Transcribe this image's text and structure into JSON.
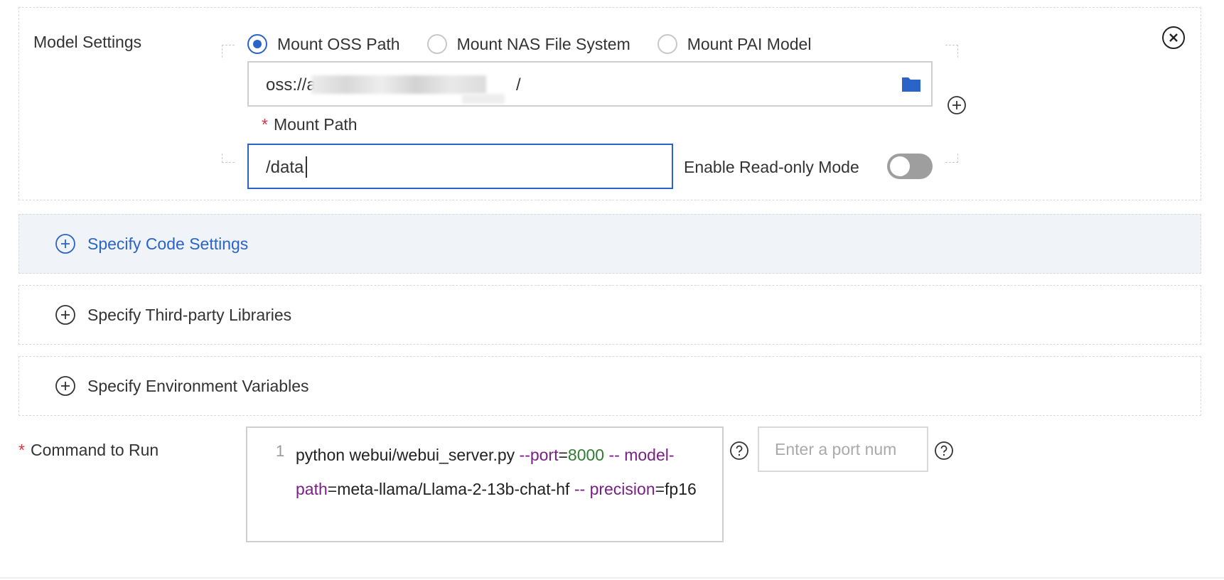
{
  "model_settings": {
    "label": "Model Settings",
    "radios": [
      {
        "label": "Mount OSS Path",
        "checked": true
      },
      {
        "label": "Mount NAS File System",
        "checked": false
      },
      {
        "label": "Mount PAI Model",
        "checked": false
      }
    ],
    "oss_path_prefix": "oss://a",
    "oss_path_suffix": "/",
    "mount_path_label": "Mount Path",
    "mount_path_value": "/data",
    "readonly_label": "Enable Read-only Mode",
    "readonly_enabled": false
  },
  "sections": {
    "code": "Specify Code Settings",
    "libraries": "Specify Third-party Libraries",
    "env": "Specify Environment Variables"
  },
  "command": {
    "label": "Command to Run",
    "line_number": "1",
    "segments": {
      "s1": "python webui/webui_server.py ",
      "s2": "--port",
      "s3": "=",
      "s4": "8000",
      "s5": " --",
      "s6": "model-path",
      "s7": "=meta-llama/Llama-2-13b-chat-hf ",
      "s8": "--",
      "s9": "precision",
      "s10": "=fp16"
    }
  },
  "port": {
    "placeholder": "Enter a port num"
  },
  "colors": {
    "accent": "#2a64c8",
    "required": "#d9363e",
    "keyword": "#7a1f86",
    "number": "#2e7d32"
  },
  "icons": {
    "folder": "folder-icon",
    "close": "close-circle-icon",
    "add": "plus-circle-icon",
    "help": "question-circle-icon"
  }
}
